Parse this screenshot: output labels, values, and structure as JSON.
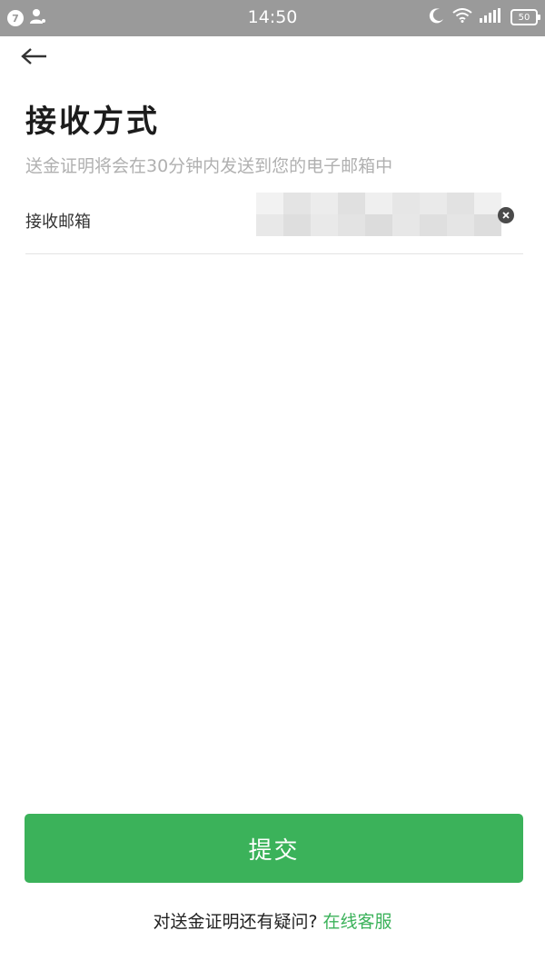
{
  "status_bar": {
    "notification_count": "7",
    "time": "14:50",
    "battery_level": "50",
    "icons": [
      "notification-badge",
      "person-icon",
      "moon-icon",
      "wifi-icon",
      "signal-icon",
      "battery-icon"
    ]
  },
  "header": {
    "back_icon": "back-arrow-icon"
  },
  "page": {
    "title": "接收方式",
    "subtitle": "送金证明将会在30分钟内发送到您的电子邮箱中"
  },
  "form": {
    "email_label": "接收邮箱",
    "email_value": "",
    "clear_icon": "clear-icon"
  },
  "actions": {
    "submit_label": "提交"
  },
  "footer": {
    "question": "对送金证明还有疑问?",
    "link": "在线客服"
  },
  "colors": {
    "accent": "#3bb25a",
    "status_bar_bg": "#9a9a9a",
    "subtitle": "#b0b0b0",
    "divider": "#e3e3e3"
  }
}
